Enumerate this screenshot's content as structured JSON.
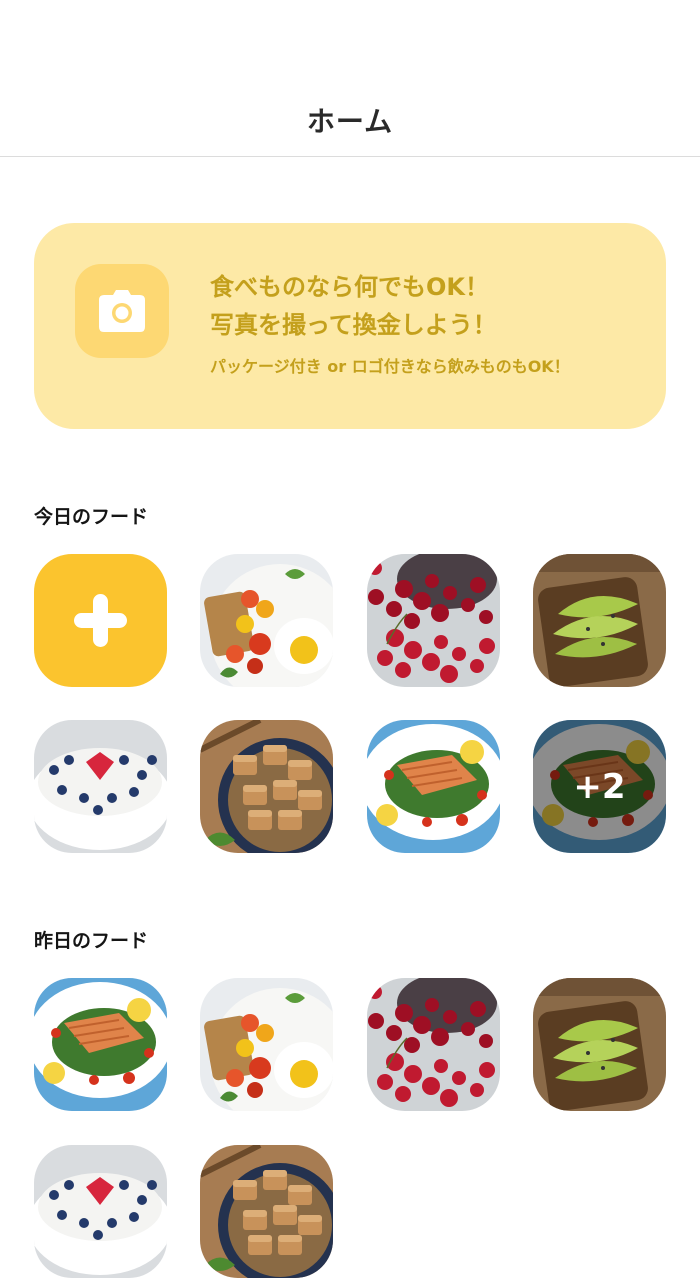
{
  "header": {
    "title": "ホーム"
  },
  "banner": {
    "line1": "食べものなら何でもOK！",
    "line2": "写真を撮って換金しよう！",
    "sub": "パッケージ付き or ロゴ付きなら飲みものもOK！"
  },
  "today": {
    "title": "今日のフード",
    "items": [
      "eggs-toast",
      "cherries",
      "avocado-toast",
      "yogurt-berries",
      "tofu-bowl",
      "salmon-salad",
      "salmon-salad"
    ],
    "more_label": "+2"
  },
  "yesterday": {
    "title": "昨日のフード",
    "items": [
      "salmon-salad",
      "eggs-toast",
      "cherries",
      "avocado-toast",
      "yogurt-berries",
      "tofu-bowl"
    ]
  },
  "colors": {
    "accent": "#fbc42e",
    "banner_bg": "#fde9a6",
    "banner_text": "#c4a01c"
  }
}
